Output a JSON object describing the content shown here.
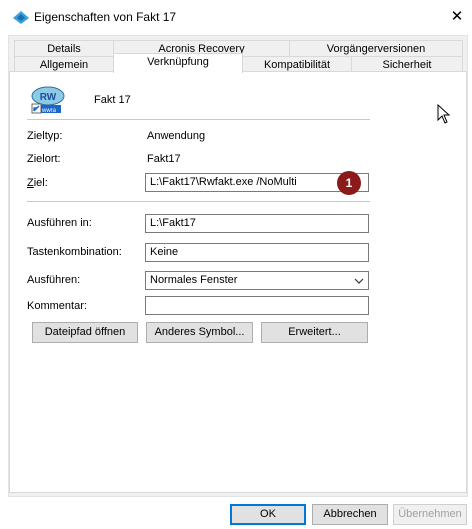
{
  "window": {
    "title": "Eigenschaften von Fakt 17",
    "close_glyph": "✕"
  },
  "tabs": {
    "row1": [
      "Details",
      "Acronis Recovery",
      "Vorgängerversionen"
    ],
    "row2": [
      "Allgemein",
      "Verknüpfung",
      "Kompatibilität",
      "Sicherheit"
    ],
    "active": "Verknüpfung"
  },
  "shortcut": {
    "name": "Fakt 17",
    "icon": "app-shortcut-icon",
    "icon_text": "RW",
    "icon_subtext": "wwra"
  },
  "fields": {
    "zieltyp_label": "Zieltyp:",
    "zieltyp_value": "Anwendung",
    "zielort_label": "Zielort:",
    "zielort_value": "Fakt17",
    "ziel_label": "Ziel:",
    "ziel_value": "L:\\Fakt17\\Rwfakt.exe /NoMulti",
    "ausfuehren_in_label": "Ausführen in:",
    "ausfuehren_in_value": "L:\\Fakt17",
    "tastenkombination_label": "Tastenkombination:",
    "tastenkombination_value": "Keine",
    "ausfuehren_label": "Ausführen:",
    "ausfuehren_value": "Normales Fenster",
    "kommentar_label": "Kommentar:",
    "kommentar_value": ""
  },
  "buttons": {
    "dateipfad": "Dateipfad öffnen",
    "anderes_symbol": "Anderes Symbol...",
    "erweitert": "Erweitert...",
    "ok": "OK",
    "abbrechen": "Abbrechen",
    "uebernehmen": "Übernehmen"
  },
  "annotation": {
    "badge": "1"
  }
}
